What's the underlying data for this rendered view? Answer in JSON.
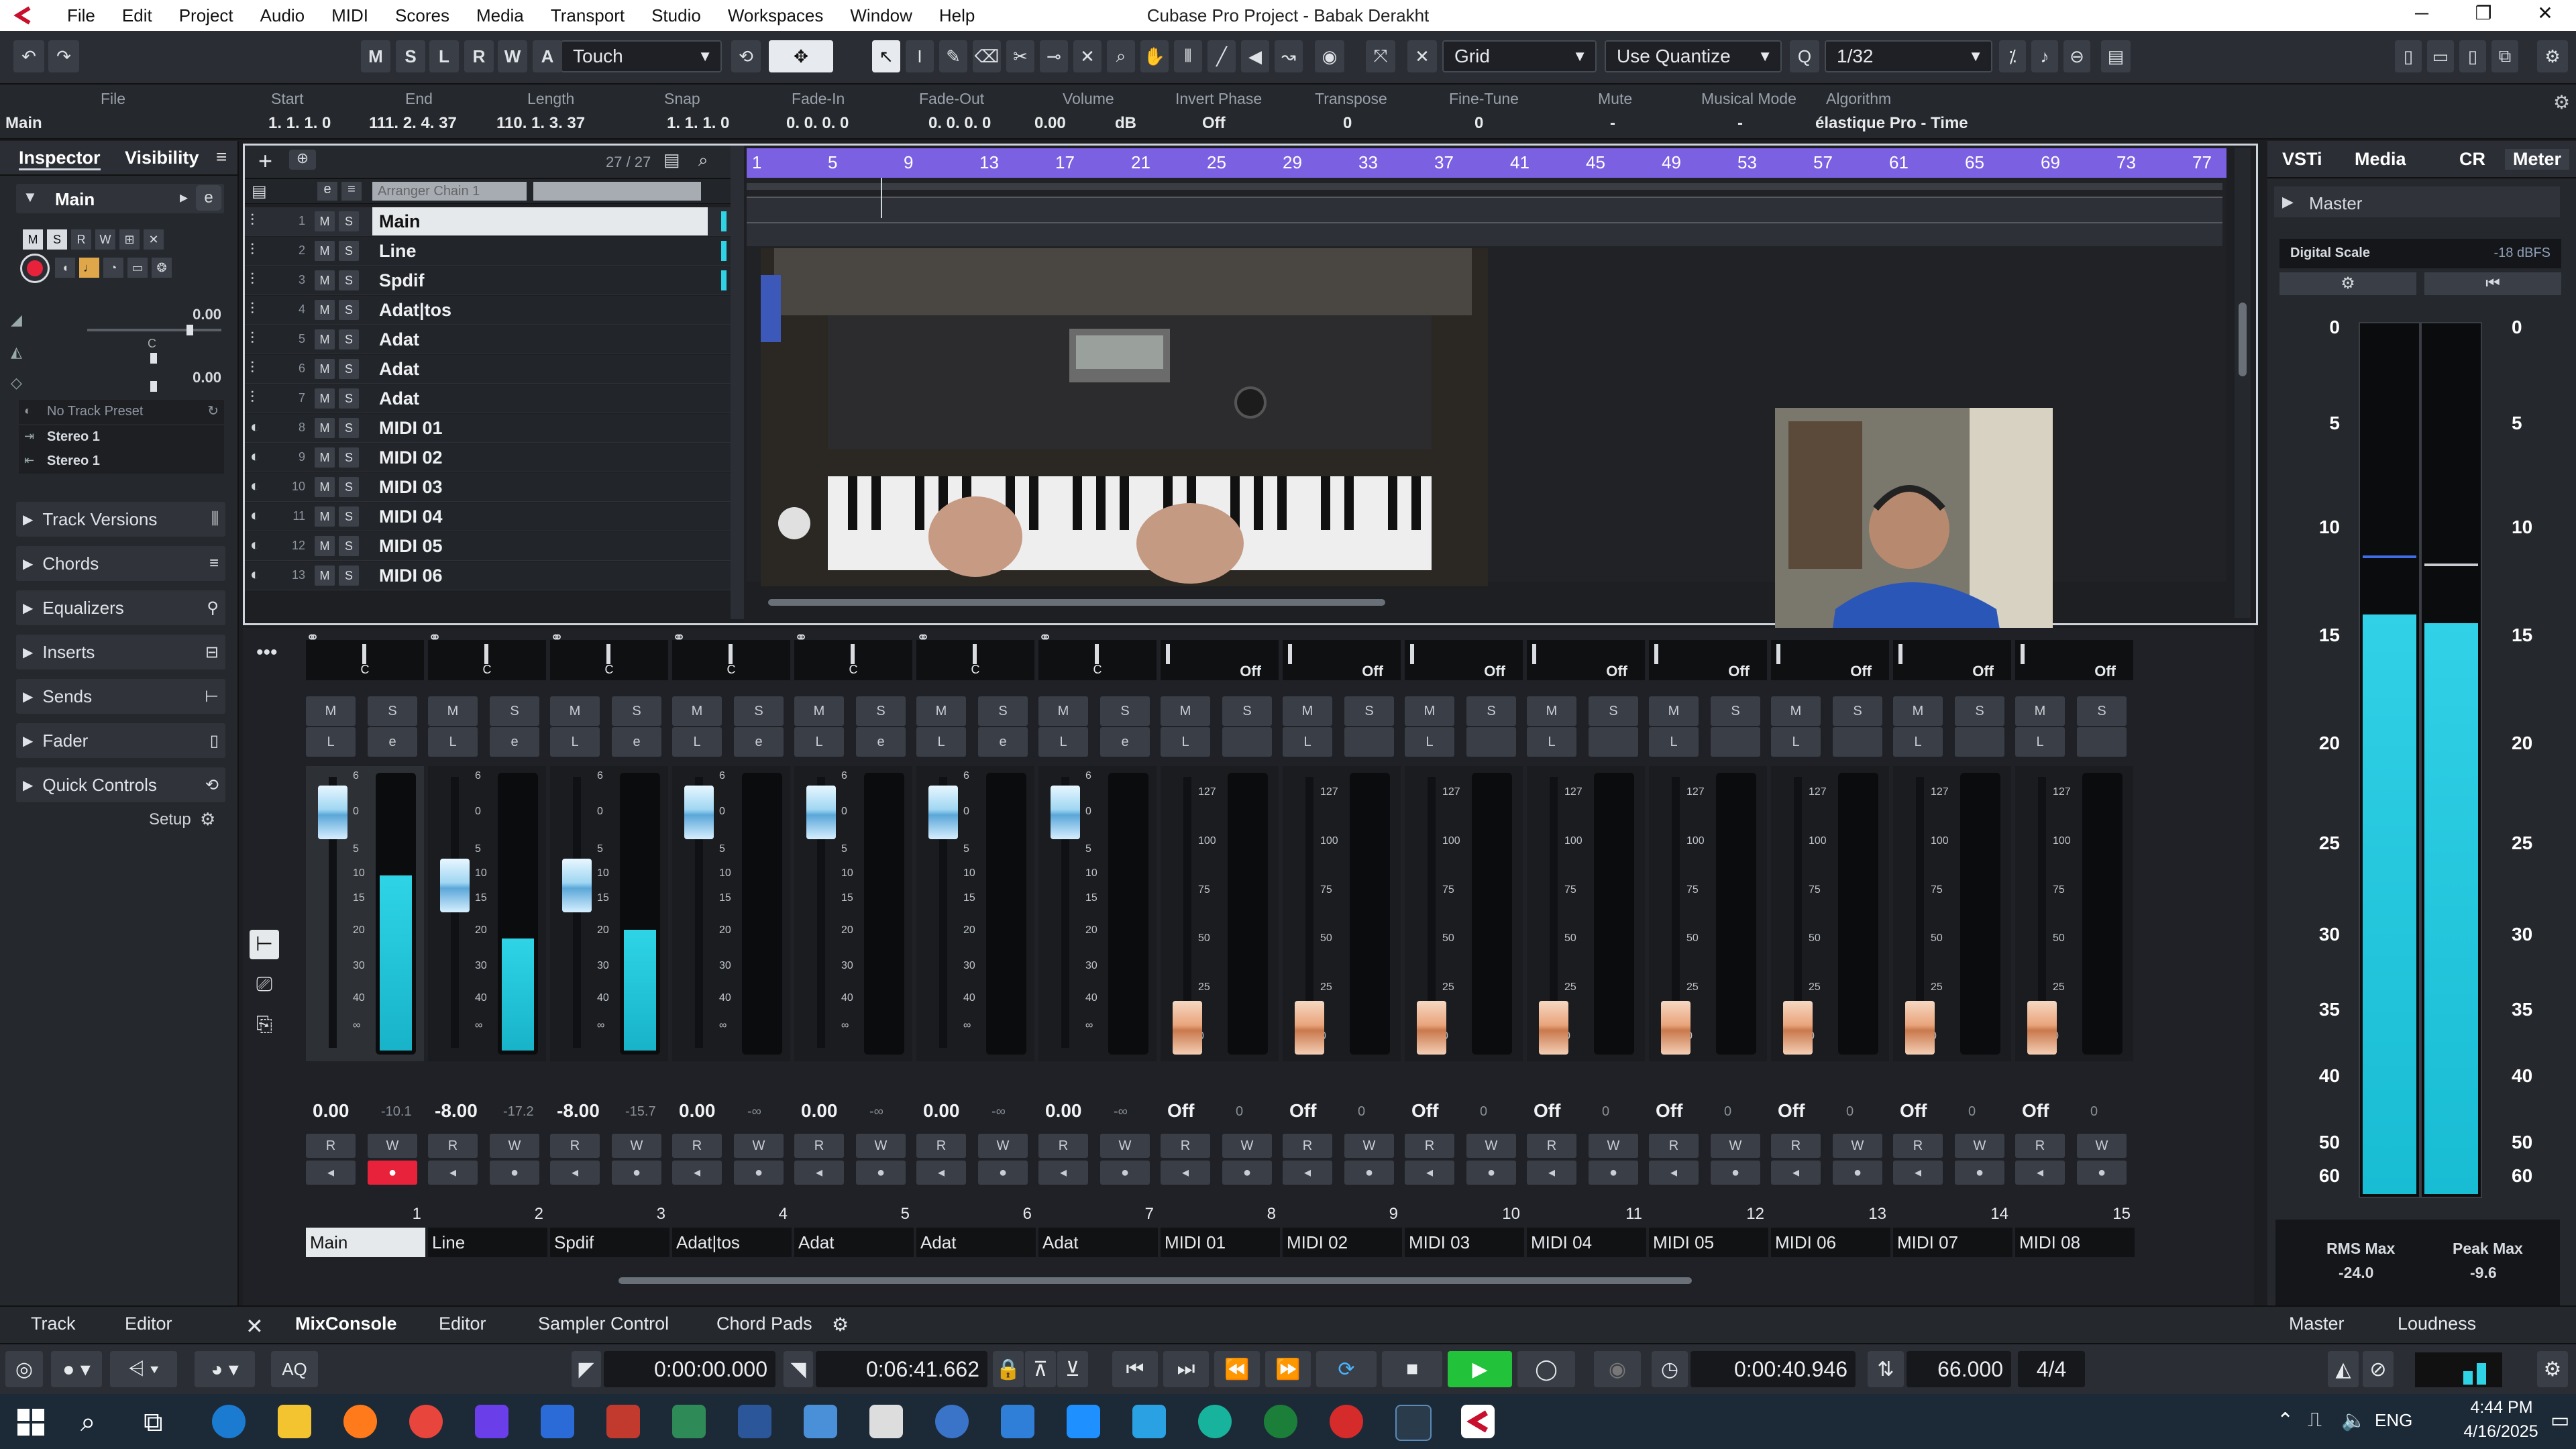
{
  "app": {
    "window_title": "Cubase Pro Project - Babak Derakht",
    "menu": [
      "File",
      "Edit",
      "Project",
      "Audio",
      "MIDI",
      "Scores",
      "Media",
      "Transport",
      "Studio",
      "Workspaces",
      "Window",
      "Help"
    ],
    "window_buttons": [
      "─",
      "❐",
      "✕"
    ]
  },
  "toolbar": {
    "mode_buttons": [
      "M",
      "S",
      "L",
      "R",
      "W",
      "A"
    ],
    "automation_mode": "Touch",
    "snap_type": "Grid",
    "quantize_mode": "Use Quantize",
    "quantize_value": "1/32"
  },
  "infoline": {
    "fields": [
      {
        "head": "File",
        "value": "Main"
      },
      {
        "head": "Start",
        "value": "1. 1. 1.   0"
      },
      {
        "head": "End",
        "value": "111. 2. 4. 37"
      },
      {
        "head": "Length",
        "value": "110. 1. 3. 37"
      },
      {
        "head": "Snap",
        "value": "1. 1. 1.   0"
      },
      {
        "head": "Fade-In",
        "value": "0. 0. 0.   0"
      },
      {
        "head": "Fade-Out",
        "value": "0. 0. 0.   0"
      },
      {
        "head": "Volume",
        "value": "0.00"
      },
      {
        "head": "Volume unit",
        "value": "dB"
      },
      {
        "head": "Invert Phase",
        "value": "Off"
      },
      {
        "head": "Transpose",
        "value": "0"
      },
      {
        "head": "Fine-Tune",
        "value": "0"
      },
      {
        "head": "Mute",
        "value": "-"
      },
      {
        "head": "Musical Mode",
        "value": "-"
      },
      {
        "head": "Algorithm",
        "value": "élastique Pro - Time"
      }
    ]
  },
  "inspector": {
    "tabs": [
      "Inspector",
      "Visibility"
    ],
    "track_name": "Main",
    "volume_value": "0.00",
    "pan_label": "C",
    "delay_value": "0.00",
    "preset": "No Track Preset",
    "in_routing": "Stereo 1",
    "out_routing": "Stereo 1",
    "sections": [
      "Track Versions",
      "Chords",
      "Equalizers",
      "Inserts",
      "Sends",
      "Fader",
      "Quick Controls"
    ],
    "setup_label": "Setup"
  },
  "project": {
    "track_count": "27 / 27",
    "arranger_label": "Arranger Chain 1",
    "tracks": [
      {
        "num": "1",
        "name": "Main"
      },
      {
        "num": "2",
        "name": "Line"
      },
      {
        "num": "3",
        "name": "Spdif"
      },
      {
        "num": "4",
        "name": "Adat|tos"
      },
      {
        "num": "5",
        "name": "Adat"
      },
      {
        "num": "6",
        "name": "Adat"
      },
      {
        "num": "7",
        "name": "Adat"
      },
      {
        "num": "8",
        "name": "MIDI 01"
      },
      {
        "num": "9",
        "name": "MIDI 02"
      },
      {
        "num": "10",
        "name": "MIDI 03"
      },
      {
        "num": "11",
        "name": "MIDI 04"
      },
      {
        "num": "12",
        "name": "MIDI 05"
      },
      {
        "num": "13",
        "name": "MIDI 06"
      }
    ],
    "ruler": [
      "1",
      "5",
      "9",
      "13",
      "17",
      "21",
      "25",
      "29",
      "33",
      "37",
      "41",
      "45",
      "49",
      "53",
      "57",
      "61",
      "65",
      "69",
      "73",
      "77"
    ]
  },
  "mixer": {
    "channels": [
      {
        "num": "1",
        "name": "Main",
        "pan": "C",
        "value": "0.00",
        "peak": "-10.1",
        "type": "audio",
        "level": 0.64,
        "fader": 0.87
      },
      {
        "num": "2",
        "name": "Line",
        "pan": "C",
        "value": "-8.00",
        "peak": "-17.2",
        "type": "audio",
        "level": 0.41,
        "fader": 0.6
      },
      {
        "num": "3",
        "name": "Spdif",
        "pan": "C",
        "value": "-8.00",
        "peak": "-15.7",
        "type": "audio",
        "level": 0.44,
        "fader": 0.6
      },
      {
        "num": "4",
        "name": "Adat|tos",
        "pan": "C",
        "value": "0.00",
        "peak": "-∞",
        "type": "audio",
        "level": 0,
        "fader": 0.87
      },
      {
        "num": "5",
        "name": "Adat",
        "pan": "C",
        "value": "0.00",
        "peak": "-∞",
        "type": "audio",
        "level": 0,
        "fader": 0.87
      },
      {
        "num": "6",
        "name": "Adat",
        "pan": "C",
        "value": "0.00",
        "peak": "-∞",
        "type": "audio",
        "level": 0,
        "fader": 0.87
      },
      {
        "num": "7",
        "name": "Adat",
        "pan": "C",
        "value": "0.00",
        "peak": "-∞",
        "type": "audio",
        "level": 0,
        "fader": 0.87
      },
      {
        "num": "8",
        "name": "MIDI 01",
        "pan": "Off",
        "value": "Off",
        "peak": "0",
        "type": "midi",
        "level": 0,
        "fader": 0.0
      },
      {
        "num": "9",
        "name": "MIDI 02",
        "pan": "Off",
        "value": "Off",
        "peak": "0",
        "type": "midi",
        "level": 0,
        "fader": 0.0
      },
      {
        "num": "10",
        "name": "MIDI 03",
        "pan": "Off",
        "value": "Off",
        "peak": "0",
        "type": "midi",
        "level": 0,
        "fader": 0.0
      },
      {
        "num": "11",
        "name": "MIDI 04",
        "pan": "Off",
        "value": "Off",
        "peak": "0",
        "type": "midi",
        "level": 0,
        "fader": 0.0
      },
      {
        "num": "12",
        "name": "MIDI 05",
        "pan": "Off",
        "value": "Off",
        "peak": "0",
        "type": "midi",
        "level": 0,
        "fader": 0.0
      },
      {
        "num": "13",
        "name": "MIDI 06",
        "pan": "Off",
        "value": "Off",
        "peak": "0",
        "type": "midi",
        "level": 0,
        "fader": 0.0
      },
      {
        "num": "14",
        "name": "MIDI 07",
        "pan": "Off",
        "value": "Off",
        "peak": "0",
        "type": "midi",
        "level": 0,
        "fader": 0.0
      },
      {
        "num": "15",
        "name": "MIDI 08",
        "pan": "Off",
        "value": "Off",
        "peak": "0",
        "type": "midi",
        "level": 0,
        "fader": 0.0
      }
    ],
    "audio_scale": [
      "6",
      "0",
      "5",
      "10",
      "15",
      "20",
      "30",
      "40",
      "∞"
    ],
    "midi_scale": [
      "127",
      "100",
      "75",
      "50",
      "25",
      "0"
    ]
  },
  "rightzone": {
    "tabs": [
      "VSTi",
      "Media",
      "CR",
      "Meter"
    ],
    "master_label": "Master",
    "digital_scale_label": "Digital Scale",
    "digital_scale_value": "-18 dBFS",
    "scale": [
      "0",
      "5",
      "10",
      "15",
      "20",
      "25",
      "30",
      "35",
      "40",
      "50",
      "60"
    ],
    "meter_levels": [
      0.67,
      0.66
    ],
    "rms_label": "RMS Max",
    "rms_value": "-24.0",
    "peak_label": "Peak Max",
    "peak_value": "-9.6",
    "bottom_tabs": [
      "Master",
      "Loudness"
    ]
  },
  "bottom_tabs": [
    "Track",
    "Editor",
    "MixConsole",
    "Editor",
    "Sampler Control",
    "Chord Pads"
  ],
  "transport": {
    "aq": "AQ",
    "left_locator": "0:00:00.000",
    "right_locator": "0:06:41.662",
    "position": "0:00:40.946",
    "tempo": "66.000",
    "signature": "4/4"
  },
  "taskbar": {
    "time": "4:44 PM",
    "date": "4/16/2025",
    "lang": "ENG"
  }
}
